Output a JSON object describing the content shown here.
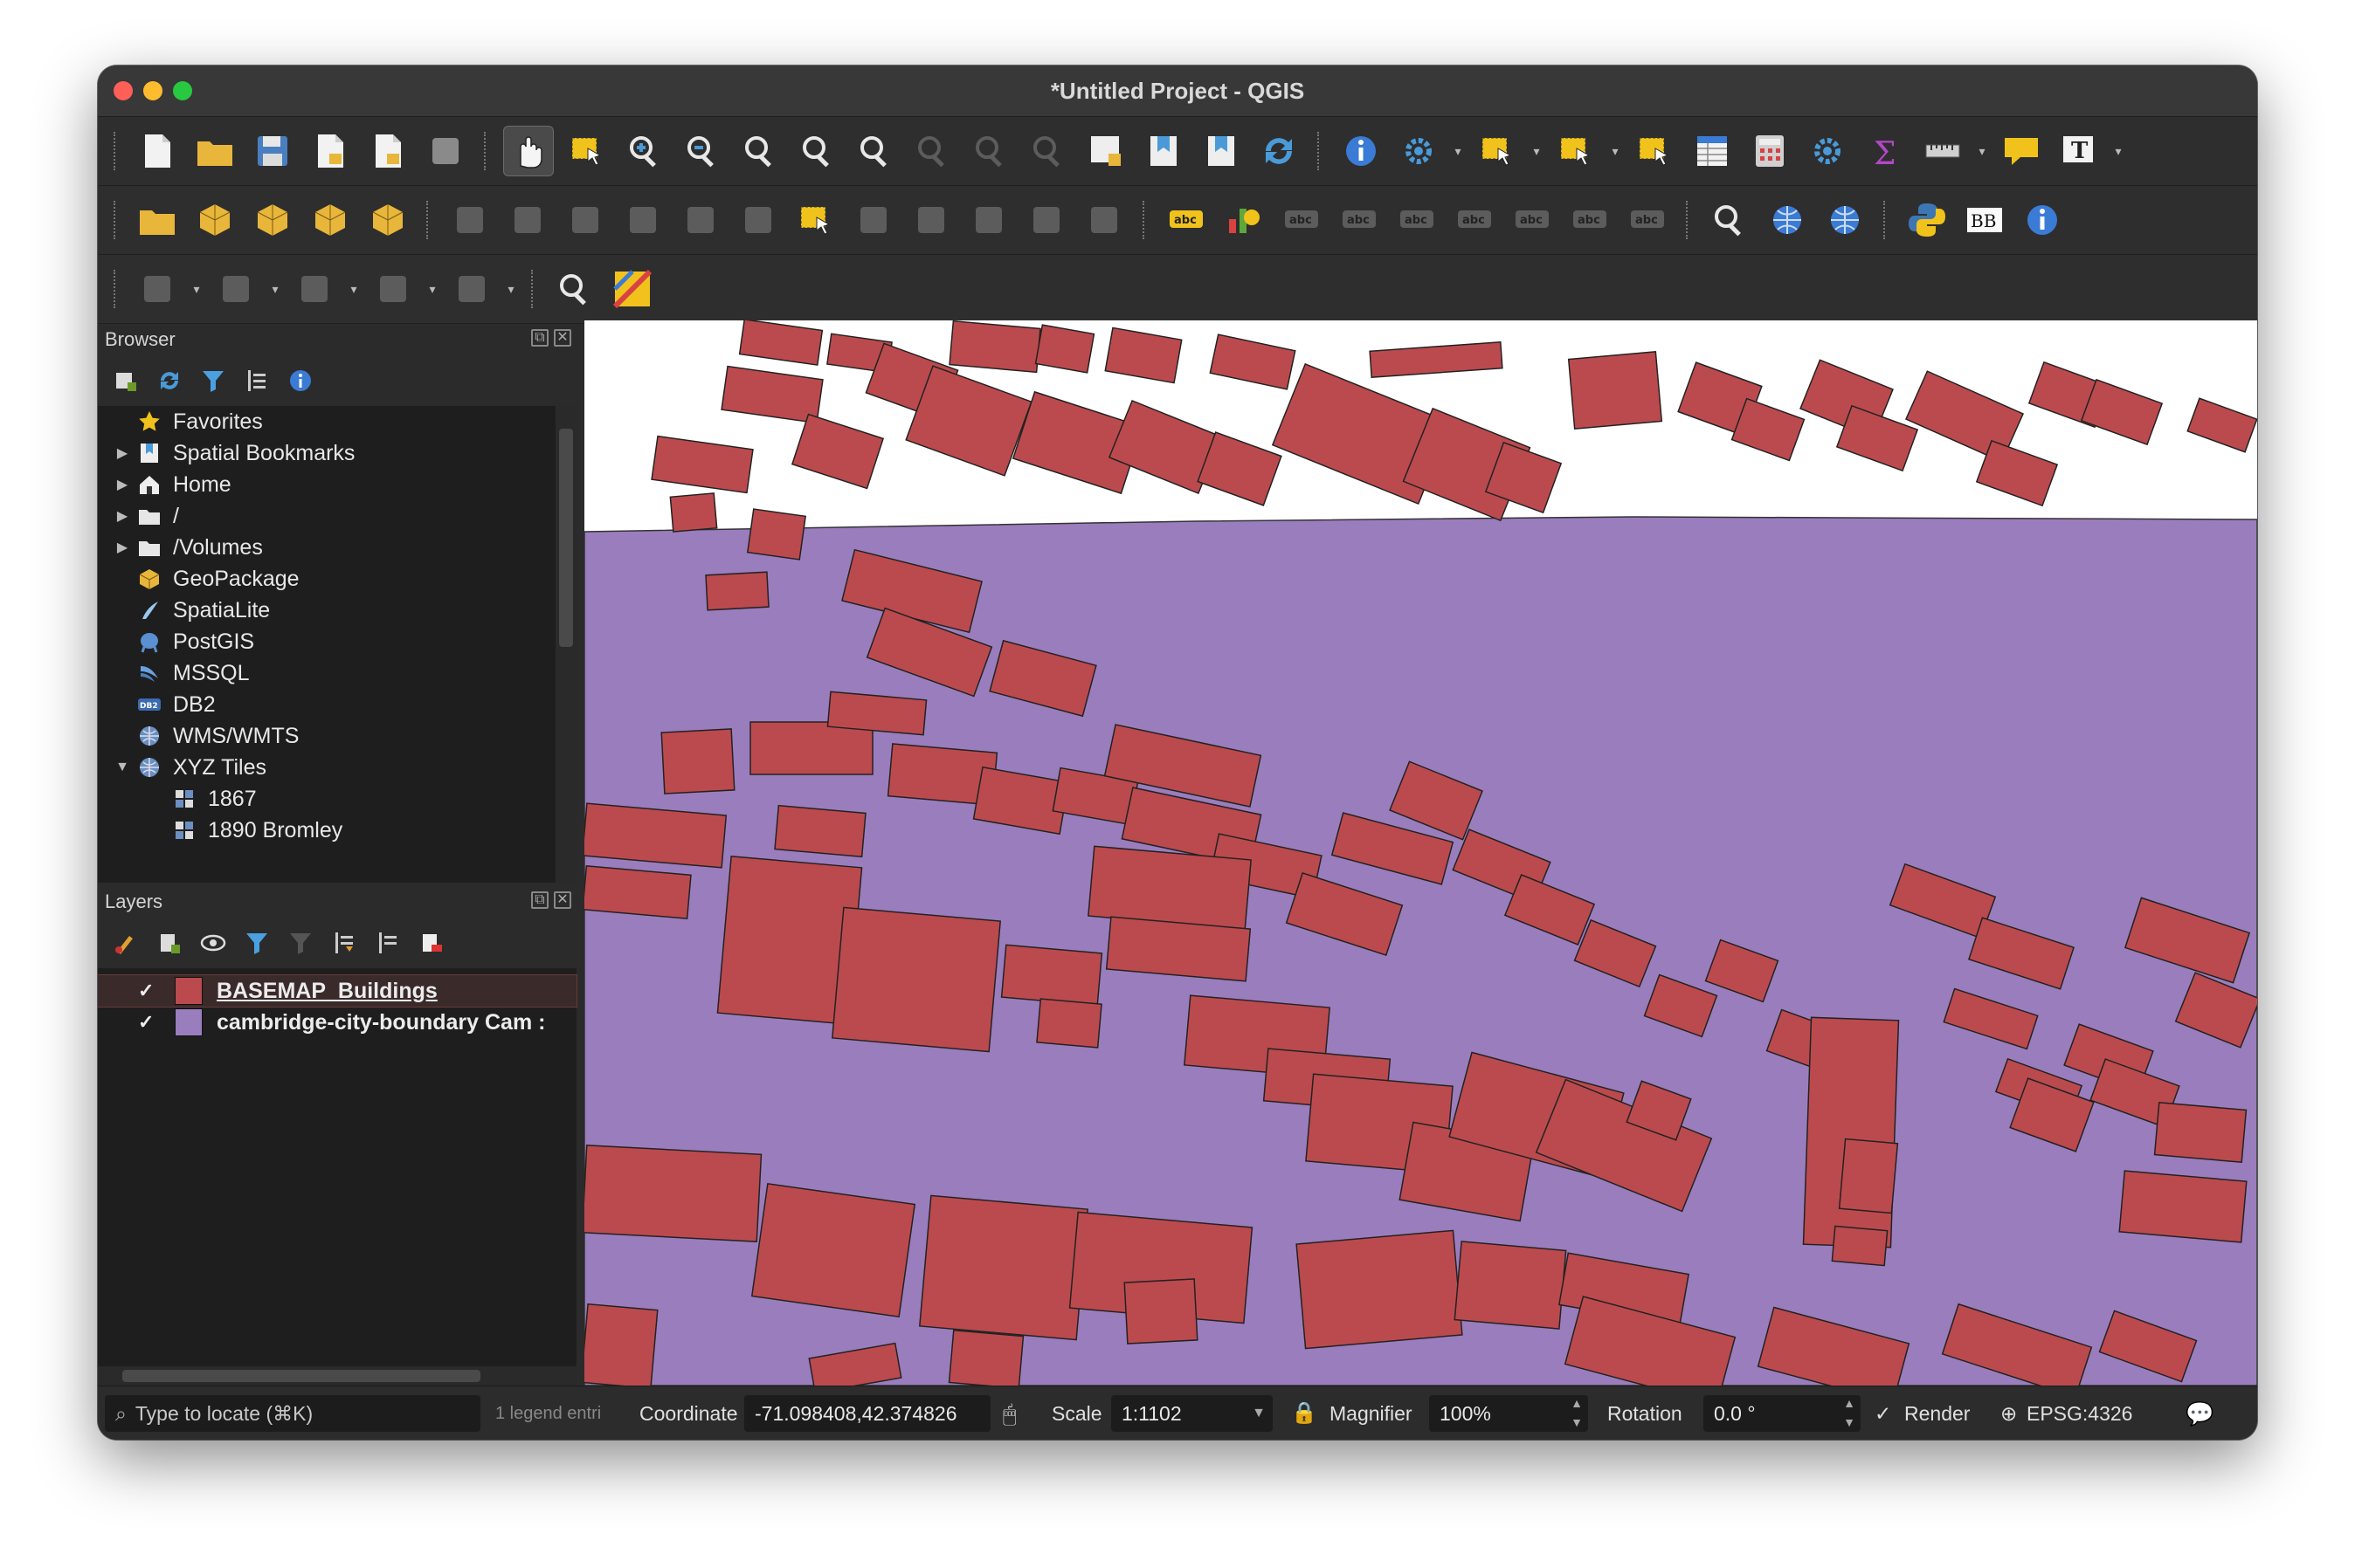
{
  "window": {
    "title": "*Untitled Project - QGIS"
  },
  "toolbar1": {
    "icons": [
      "new-project",
      "open-project",
      "save-project",
      "new-print-layout",
      "layout-manager",
      "style-manager",
      "pan-map",
      "pan-to-selection",
      "zoom-in",
      "zoom-out",
      "zoom-full",
      "zoom-to-selection",
      "zoom-to-layer",
      "zoom-native",
      "zoom-last",
      "zoom-next",
      "new-map-view",
      "new-bookmark",
      "show-bookmarks",
      "refresh",
      "identify",
      "run-action",
      "select-features",
      "select-by-value",
      "deselect",
      "attribute-table",
      "field-calculator",
      "toolbox",
      "statistics",
      "measure",
      "map-tips",
      "text-annotation"
    ]
  },
  "toolbar2": {
    "icons": [
      "data-source-manager",
      "new-geopackage",
      "new-temp-scratch",
      "new-spatialite",
      "new-virtual",
      "digitize-toggle",
      "edit-pencil",
      "save-edits",
      "add-feature",
      "vertex-tool",
      "modify-attributes",
      "delete-selected",
      "cut-features",
      "copy-features",
      "paste-features",
      "undo",
      "redo",
      "label-toolbar",
      "diagram",
      "label-pin",
      "label-highlight",
      "show-hide-labels",
      "move-label",
      "rotate-label",
      "change-label",
      "label-properties",
      "metasearch",
      "wms",
      "osm",
      "python-console",
      "bb-plugin",
      "help"
    ]
  },
  "toolbar3": {
    "icons": [
      "digitize-curve",
      "shape-circle",
      "shape-ellipse",
      "shape-rectangle",
      "shape-polygon",
      "locator-search",
      "qgis-plugin"
    ]
  },
  "browser": {
    "title": "Browser",
    "items": [
      {
        "label": "Favorites",
        "icon": "star-icon",
        "arrow": ""
      },
      {
        "label": "Spatial Bookmarks",
        "icon": "bookmark-icon",
        "arrow": "▶"
      },
      {
        "label": "Home",
        "icon": "home-icon",
        "arrow": "▶"
      },
      {
        "label": "/",
        "icon": "folder-icon",
        "arrow": "▶"
      },
      {
        "label": "/Volumes",
        "icon": "folder-icon",
        "arrow": "▶"
      },
      {
        "label": "GeoPackage",
        "icon": "geopackage-icon",
        "arrow": ""
      },
      {
        "label": "SpatiaLite",
        "icon": "spatialite-icon",
        "arrow": ""
      },
      {
        "label": "PostGIS",
        "icon": "postgis-icon",
        "arrow": ""
      },
      {
        "label": "MSSQL",
        "icon": "mssql-icon",
        "arrow": ""
      },
      {
        "label": "DB2",
        "icon": "db2-icon",
        "arrow": ""
      },
      {
        "label": "WMS/WMTS",
        "icon": "globe-icon",
        "arrow": ""
      },
      {
        "label": "XYZ Tiles",
        "icon": "globe-icon",
        "arrow": "▼"
      },
      {
        "label": "1867",
        "icon": "tiles-icon",
        "arrow": ""
      },
      {
        "label": "1890 Bromley",
        "icon": "tiles-icon",
        "arrow": ""
      }
    ]
  },
  "layers": {
    "title": "Layers",
    "items": [
      {
        "label": "BASEMAP_Buildings",
        "color": "#bb4a4e",
        "checked": "✓"
      },
      {
        "label": "cambridge-city-boundary Cam :",
        "color": "#9a7dbd",
        "checked": "✓"
      }
    ]
  },
  "status": {
    "locate_placeholder": "Type to locate (⌘K)",
    "legend_text": "1 legend entri",
    "coordinate_label": "Coordinate",
    "coordinate_value": "-71.098408,42.374826",
    "scale_label": "Scale",
    "scale_value": "1:1102",
    "magnifier_label": "Magnifier",
    "magnifier_value": "100%",
    "rotation_label": "Rotation",
    "rotation_value": "0.0 °",
    "render_label": "Render",
    "render_checked": "✓",
    "crs": "EPSG:4326"
  },
  "colors": {
    "building": "#bb4a4e",
    "boundary": "#9a7dbd",
    "map_background": "#ffffff"
  }
}
